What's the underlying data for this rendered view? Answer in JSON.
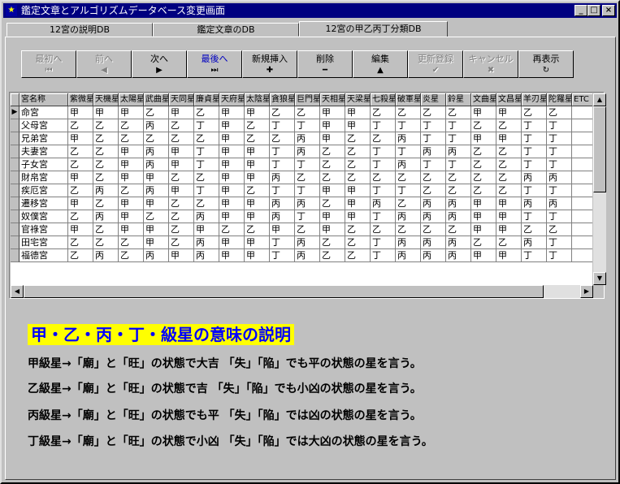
{
  "window": {
    "title": "鑑定文章とアルゴリズムデータベース変更画面",
    "app_icon": "★",
    "controls": [
      "_",
      "□",
      "×"
    ]
  },
  "tabs": [
    {
      "label": "12宮の説明DB",
      "active": false
    },
    {
      "label": "鑑定文章のDB",
      "active": false
    },
    {
      "label": "12宮の甲乙丙丁分類DB",
      "active": true
    }
  ],
  "nav": [
    {
      "label": "最初へ",
      "icon": "⏮",
      "icon_name": "first-record-icon",
      "disabled": true
    },
    {
      "label": "前へ",
      "icon": "◀",
      "icon_name": "prev-record-icon",
      "disabled": true
    },
    {
      "label": "次へ",
      "icon": "▶",
      "icon_name": "next-record-icon",
      "disabled": false
    },
    {
      "label": "最後へ",
      "icon": "⏭",
      "icon_name": "last-record-icon",
      "disabled": false,
      "accent": true
    },
    {
      "label": "新規挿入",
      "icon": "✚",
      "icon_name": "insert-icon",
      "disabled": false
    },
    {
      "label": "削除",
      "icon": "━",
      "icon_name": "delete-icon",
      "disabled": false
    },
    {
      "label": "編集",
      "icon": "▲",
      "icon_name": "edit-icon",
      "disabled": false
    },
    {
      "label": "更新登録",
      "icon": "✔",
      "icon_name": "post-icon",
      "disabled": true
    },
    {
      "label": "キャンセル",
      "icon": "✖",
      "icon_name": "cancel-icon",
      "disabled": true
    },
    {
      "label": "再表示",
      "icon": "↻",
      "icon_name": "refresh-icon",
      "disabled": false
    }
  ],
  "grid": {
    "headers": [
      "宮名称",
      "紫微星",
      "天機星",
      "太陽星",
      "武曲星",
      "天同星",
      "廉貞星",
      "天府星",
      "太陰星",
      "貪狼星",
      "巨門星",
      "天相星",
      "天梁星",
      "七殺星",
      "破軍星",
      "炎星",
      "鈴星",
      "文曲星",
      "文昌星",
      "羊刃星",
      "陀羅星",
      "ETC"
    ],
    "current_row": 0,
    "rows": [
      [
        "命宮",
        "甲",
        "甲",
        "甲",
        "乙",
        "甲",
        "乙",
        "甲",
        "甲",
        "乙",
        "乙",
        "甲",
        "甲",
        "乙",
        "乙",
        "乙",
        "乙",
        "甲",
        "甲",
        "乙",
        "乙",
        ""
      ],
      [
        "父母宮",
        "乙",
        "乙",
        "乙",
        "丙",
        "乙",
        "丁",
        "甲",
        "乙",
        "丁",
        "丁",
        "甲",
        "甲",
        "丁",
        "丁",
        "丁",
        "丁",
        "乙",
        "乙",
        "丁",
        "丁",
        ""
      ],
      [
        "兄弟宮",
        "甲",
        "乙",
        "乙",
        "乙",
        "乙",
        "乙",
        "甲",
        "乙",
        "乙",
        "丙",
        "甲",
        "乙",
        "乙",
        "丙",
        "丁",
        "丁",
        "甲",
        "甲",
        "丁",
        "丁",
        ""
      ],
      [
        "夫妻宮",
        "乙",
        "乙",
        "甲",
        "丙",
        "甲",
        "丁",
        "甲",
        "甲",
        "丁",
        "丙",
        "乙",
        "乙",
        "丁",
        "丁",
        "丙",
        "丙",
        "乙",
        "乙",
        "丁",
        "丁",
        ""
      ],
      [
        "子女宮",
        "乙",
        "乙",
        "甲",
        "丙",
        "甲",
        "丁",
        "甲",
        "甲",
        "丁",
        "丁",
        "乙",
        "乙",
        "丁",
        "丙",
        "丁",
        "丁",
        "乙",
        "乙",
        "丁",
        "丁",
        ""
      ],
      [
        "財帛宮",
        "甲",
        "乙",
        "甲",
        "甲",
        "乙",
        "乙",
        "甲",
        "甲",
        "丙",
        "乙",
        "乙",
        "乙",
        "乙",
        "乙",
        "乙",
        "乙",
        "乙",
        "乙",
        "丙",
        "丙",
        ""
      ],
      [
        "疾厄宮",
        "乙",
        "丙",
        "乙",
        "丙",
        "甲",
        "丁",
        "甲",
        "乙",
        "丁",
        "丁",
        "甲",
        "甲",
        "丁",
        "丁",
        "乙",
        "乙",
        "乙",
        "乙",
        "丁",
        "丁",
        ""
      ],
      [
        "遷移宮",
        "甲",
        "乙",
        "甲",
        "甲",
        "乙",
        "乙",
        "甲",
        "甲",
        "丙",
        "丙",
        "乙",
        "甲",
        "丙",
        "乙",
        "丙",
        "丙",
        "甲",
        "甲",
        "丙",
        "丙",
        ""
      ],
      [
        "奴僕宮",
        "乙",
        "丙",
        "甲",
        "乙",
        "乙",
        "丙",
        "甲",
        "甲",
        "丙",
        "丁",
        "甲",
        "甲",
        "丁",
        "丙",
        "丙",
        "丙",
        "甲",
        "甲",
        "丁",
        "丁",
        ""
      ],
      [
        "官祿宮",
        "甲",
        "乙",
        "甲",
        "甲",
        "乙",
        "甲",
        "乙",
        "乙",
        "甲",
        "乙",
        "甲",
        "乙",
        "乙",
        "乙",
        "乙",
        "乙",
        "甲",
        "甲",
        "乙",
        "乙",
        ""
      ],
      [
        "田宅宮",
        "乙",
        "乙",
        "乙",
        "甲",
        "乙",
        "丙",
        "甲",
        "甲",
        "丁",
        "丙",
        "乙",
        "乙",
        "丁",
        "丙",
        "丙",
        "丙",
        "乙",
        "乙",
        "丙",
        "丁",
        ""
      ],
      [
        "福德宮",
        "乙",
        "丙",
        "乙",
        "丙",
        "甲",
        "丙",
        "甲",
        "甲",
        "丁",
        "丙",
        "乙",
        "乙",
        "丁",
        "丙",
        "丙",
        "丙",
        "甲",
        "甲",
        "丁",
        "丁",
        ""
      ]
    ]
  },
  "description": {
    "title": "甲・乙・丙・丁・級星の意味の説明",
    "lines": [
      "甲級星→「廟」と「旺」の状態で大吉 「失」「陥」でも平の状態の星を言う。",
      "乙級星→「廟」と「旺」の状態で吉 「失」「陥」でも小凶の状態の星を言う。",
      "丙級星→「廟」と「旺」の状態でも平 「失」「陥」では凶の状態の星を言う。",
      "丁級星→「廟」と「旺」の状態で小凶 「失」「陥」では大凶の状態の星を言う。"
    ]
  },
  "colors": {
    "titlebar": "#000080",
    "description_title_bg": "#ffff00",
    "description_title_fg": "#0000ff",
    "disabled_text": "#808080"
  }
}
